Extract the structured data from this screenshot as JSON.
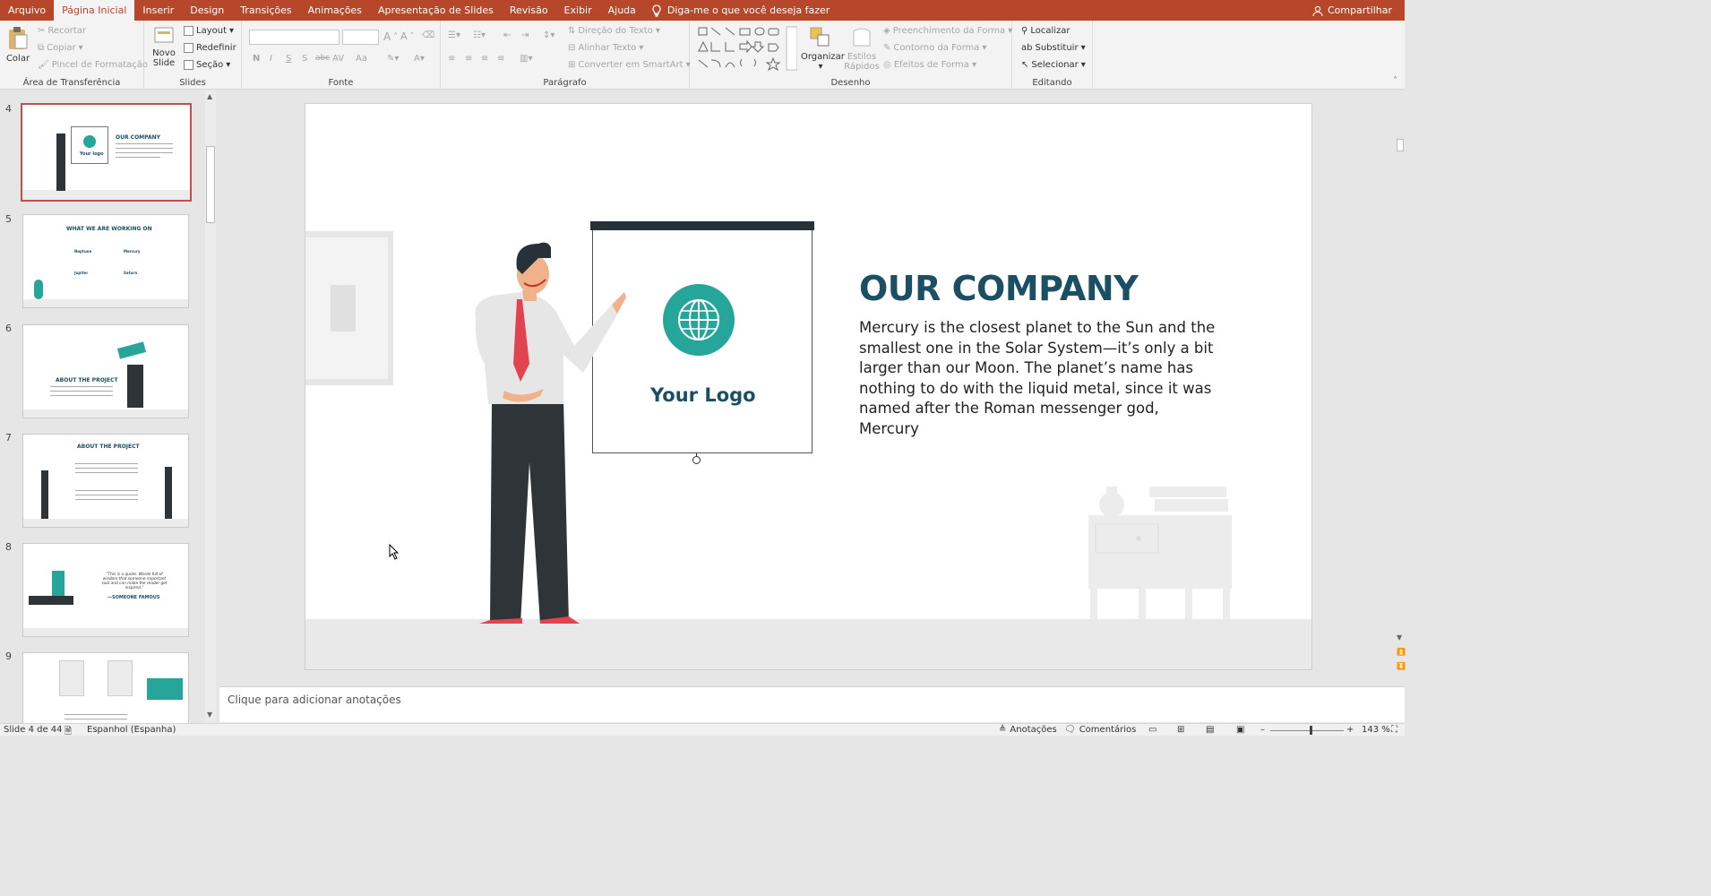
{
  "menu": {
    "items": [
      "Arquivo",
      "Página Inicial",
      "Inserir",
      "Design",
      "Transições",
      "Animações",
      "Apresentação de Slides",
      "Revisão",
      "Exibir",
      "Ajuda"
    ],
    "tell_me": "Diga-me o que você deseja fazer",
    "share": "Compartilhar"
  },
  "ribbon": {
    "clipboard": {
      "paste": "Colar",
      "cut": "Recortar",
      "copy": "Copiar",
      "format_painter": "Pincel de Formatação",
      "label": "Área de Transferência"
    },
    "slides": {
      "new_slide_1": "Novo",
      "new_slide_2": "Slide",
      "layout": "Layout",
      "reset": "Redefinir",
      "section": "Seção",
      "label": "Slides"
    },
    "font": {
      "bold": "N",
      "italic": "I",
      "underline": "S",
      "shadow": "S",
      "strike": "abc",
      "spacing": "AV",
      "case": "Aa",
      "label": "Fonte"
    },
    "paragraph": {
      "text_direction": "Direção do Texto",
      "align_text": "Alinhar Texto",
      "smartart": "Converter em SmartArt",
      "label": "Parágrafo"
    },
    "drawing": {
      "arrange": "Organizar",
      "quick_styles_1": "Estilos",
      "quick_styles_2": "Rápidos",
      "shape_fill": "Preenchimento da Forma",
      "shape_outline": "Contorno da Forma",
      "shape_effects": "Efeitos de Forma",
      "label": "Desenho"
    },
    "editing": {
      "find": "Localizar",
      "replace": "Substituir",
      "select": "Selecionar",
      "label": "Editando"
    }
  },
  "thumbnails": [
    {
      "num": "4",
      "title": "OUR COMPANY",
      "logo": "Your logo"
    },
    {
      "num": "5",
      "title": "WHAT WE ARE WORKING ON",
      "items": [
        "Neptune",
        "Mercury",
        "Jupiter",
        "Saturn"
      ]
    },
    {
      "num": "6",
      "title": "ABOUT THE PROJECT"
    },
    {
      "num": "7",
      "title": "ABOUT THE PROJECT"
    },
    {
      "num": "8",
      "quote": "“This is a quote. Words full of wisdom that someone important said and can make the reader get inspired.”",
      "author": "—SOMEONE FAMOUS"
    },
    {
      "num": "9"
    }
  ],
  "slide": {
    "title": "OUR COMPANY",
    "body": "Mercury is the closest planet to the Sun and the smallest one in the Solar System—it’s only a bit larger than our Moon. The planet’s name has nothing to do with the liquid metal, since it was named after the Roman messenger god, Mercury",
    "logo_text": "Your Logo"
  },
  "notes_placeholder": "Clique para adicionar anotações",
  "status": {
    "slide_info": "Slide 4 de 44",
    "language": "Espanhol (Espanha)",
    "notes": "Anotações",
    "comments": "Comentários",
    "zoom": "143 %",
    "zoom_minus": "–",
    "zoom_plus": "+"
  },
  "colors": {
    "accent": "#b7472a",
    "teal": "#26a69a",
    "dark_teal": "#1b5064"
  }
}
